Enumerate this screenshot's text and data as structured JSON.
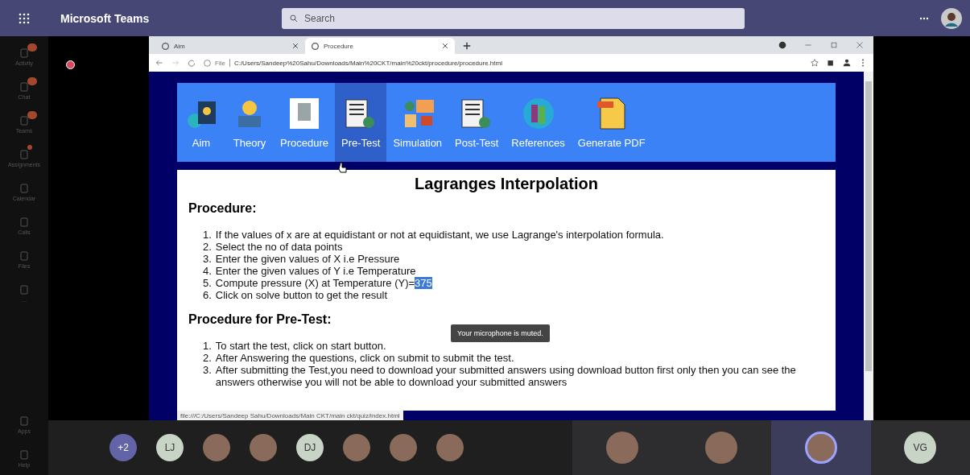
{
  "app": {
    "title": "Microsoft Teams",
    "search": {
      "placeholder": "Search"
    }
  },
  "rail": [
    {
      "label": "Activity",
      "badge": true
    },
    {
      "label": "Chat",
      "badge": true
    },
    {
      "label": "Teams",
      "badge": true
    },
    {
      "label": "Assignments",
      "badge": true
    },
    {
      "label": "Calendar",
      "badge": false
    },
    {
      "label": "Calls",
      "badge": false
    },
    {
      "label": "Files",
      "badge": false
    },
    {
      "label": "...",
      "badge": false
    }
  ],
  "rail_bottom": [
    {
      "label": "Apps"
    },
    {
      "label": "Help"
    }
  ],
  "browser": {
    "tabs": [
      {
        "label": "Aim",
        "selected": false
      },
      {
        "label": "Procedure",
        "selected": true
      }
    ],
    "url_prefix": "File",
    "url": "C:/Users/Sandeep%20Sahu/Downloads/Main%20CKT/main%20ckt/procedure/procedure.html",
    "status_url": "file:///C:/Users/Sandeep Sahu/Downloads/Main CKT/main ckt/quiz/index.html"
  },
  "nav": [
    {
      "label": "Aim",
      "selected": false
    },
    {
      "label": "Theory",
      "selected": false
    },
    {
      "label": "Procedure",
      "selected": false
    },
    {
      "label": "Pre-Test",
      "selected": true
    },
    {
      "label": "Simulation",
      "selected": false
    },
    {
      "label": "Post-Test",
      "selected": false
    },
    {
      "label": "References",
      "selected": false
    },
    {
      "label": "Generate PDF",
      "selected": false
    }
  ],
  "page": {
    "title": "Lagranges Interpolation",
    "sections": [
      {
        "heading": "Procedure:",
        "steps": [
          {
            "number": "1.",
            "text": "If the values of x are at equidistant or not at equidistant, we use Lagrange's interpolation formula."
          },
          {
            "number": "2.",
            "text": "Select the no of data points"
          },
          {
            "number": "3.",
            "text": "Enter the given values of X i.e Pressure"
          },
          {
            "number": "4.",
            "text": "Enter the given values of Y i.e Temperature"
          },
          {
            "number": "5.",
            "text": "Compute pressure (X) at Temperature (Y)=",
            "selected_text": "375"
          },
          {
            "number": "6.",
            "text": "Click on solve button to get the result"
          }
        ]
      },
      {
        "heading": "Procedure for Pre-Test:",
        "steps": [
          {
            "number": "1.",
            "text": "To start the test, click on start button."
          },
          {
            "number": "2.",
            "text": "After Answering the questions, click on submit to submit the test."
          },
          {
            "number": "3.",
            "text": "After submitting the Test,you need to download your submitted answers using download button first only then you can see the answers otherwise you will not be able to download your submitted answers"
          }
        ]
      }
    ]
  },
  "tooltip": "Your microphone is muted.",
  "participants": [
    {
      "kind": "count",
      "label": "+2"
    },
    {
      "kind": "initials",
      "label": "LJ"
    },
    {
      "kind": "photo"
    },
    {
      "kind": "photo"
    },
    {
      "kind": "initials",
      "label": "DJ"
    },
    {
      "kind": "photo"
    },
    {
      "kind": "photo"
    },
    {
      "kind": "photo"
    }
  ],
  "tiles": [
    {
      "kind": "photo",
      "speaking": false
    },
    {
      "kind": "photo",
      "speaking": false
    },
    {
      "kind": "photo",
      "speaking": true
    },
    {
      "kind": "initials",
      "label": "VG",
      "speaking": false
    }
  ]
}
